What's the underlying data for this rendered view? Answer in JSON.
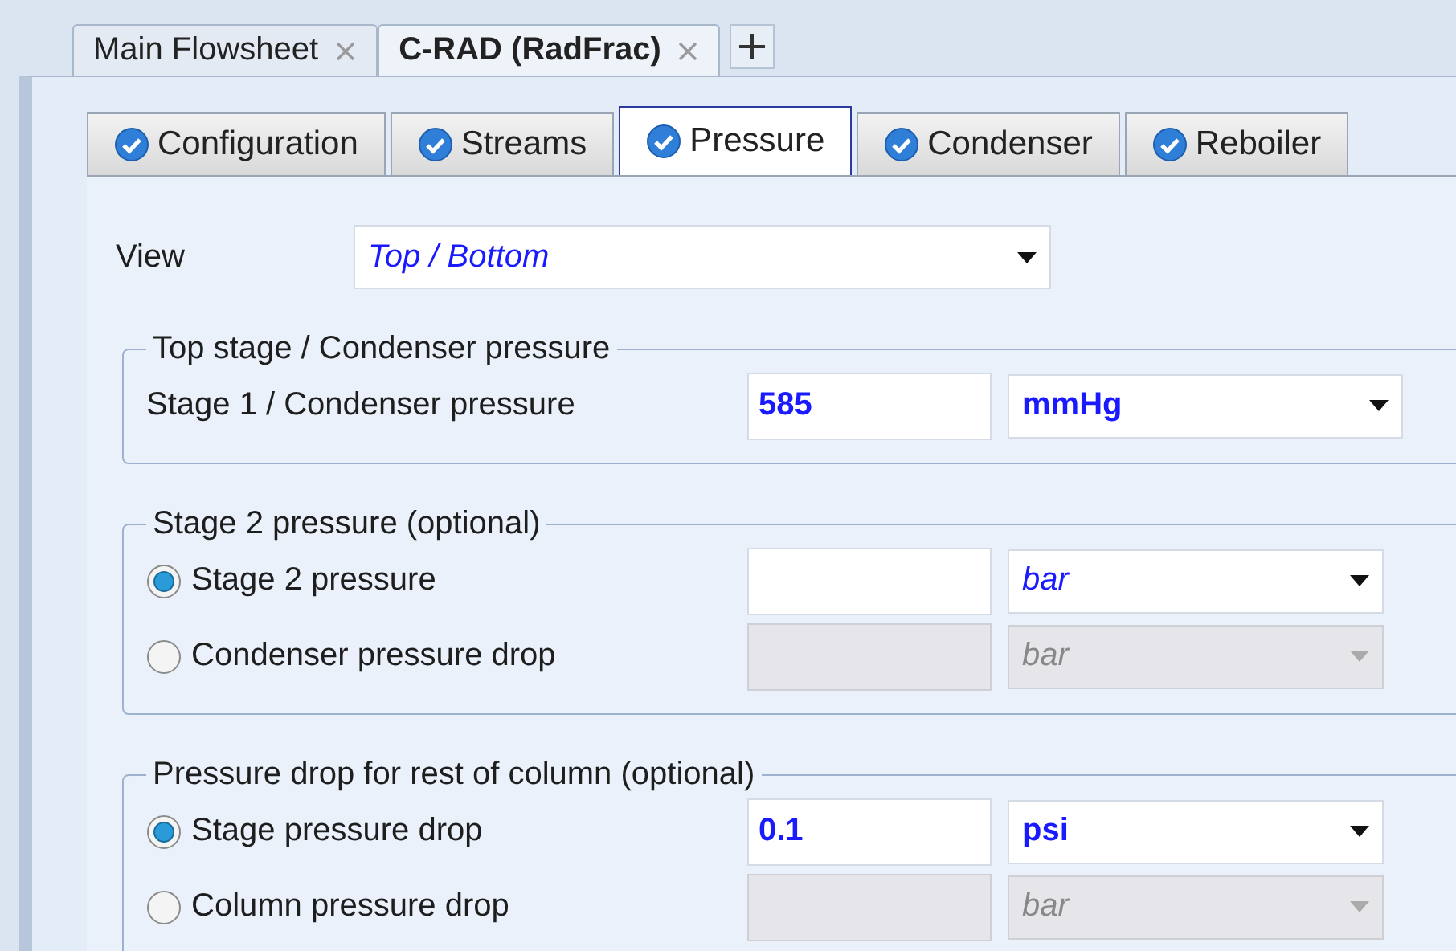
{
  "doc_tabs": [
    {
      "label": "Main Flowsheet",
      "selected": false
    },
    {
      "label": "C-RAD (RadFrac)",
      "selected": true
    }
  ],
  "form_tabs": [
    {
      "label": "Configuration",
      "selected": false
    },
    {
      "label": "Streams",
      "selected": false
    },
    {
      "label": "Pressure",
      "selected": true
    },
    {
      "label": "Condenser",
      "selected": false
    },
    {
      "label": "Reboiler",
      "selected": false
    }
  ],
  "view": {
    "label": "View",
    "value": "Top / Bottom"
  },
  "groups": [
    {
      "title": "Top stage / Condenser pressure",
      "rows": [
        {
          "kind": "plain",
          "label": "Stage 1 / Condenser pressure",
          "value": "585",
          "unit": "mmHg",
          "unit_default": false,
          "disabled": false
        }
      ]
    },
    {
      "title": "Stage 2 pressure (optional)",
      "rows": [
        {
          "kind": "radio",
          "label": "Stage 2 pressure",
          "selected": true,
          "unit": "bar",
          "unit_default": true,
          "disabled": false
        },
        {
          "kind": "radio",
          "label": "Condenser pressure drop",
          "selected": false,
          "unit": "bar",
          "unit_default": true,
          "disabled": true
        }
      ]
    },
    {
      "title": "Pressure drop for rest of column (optional)",
      "rows": [
        {
          "kind": "radio",
          "label": "Stage pressure drop",
          "selected": true,
          "value": "0.1",
          "unit": "psi",
          "unit_default": false,
          "disabled": false
        },
        {
          "kind": "radio",
          "label": "Column pressure drop",
          "selected": false,
          "unit": "bar",
          "unit_default": true,
          "disabled": true
        }
      ]
    }
  ]
}
